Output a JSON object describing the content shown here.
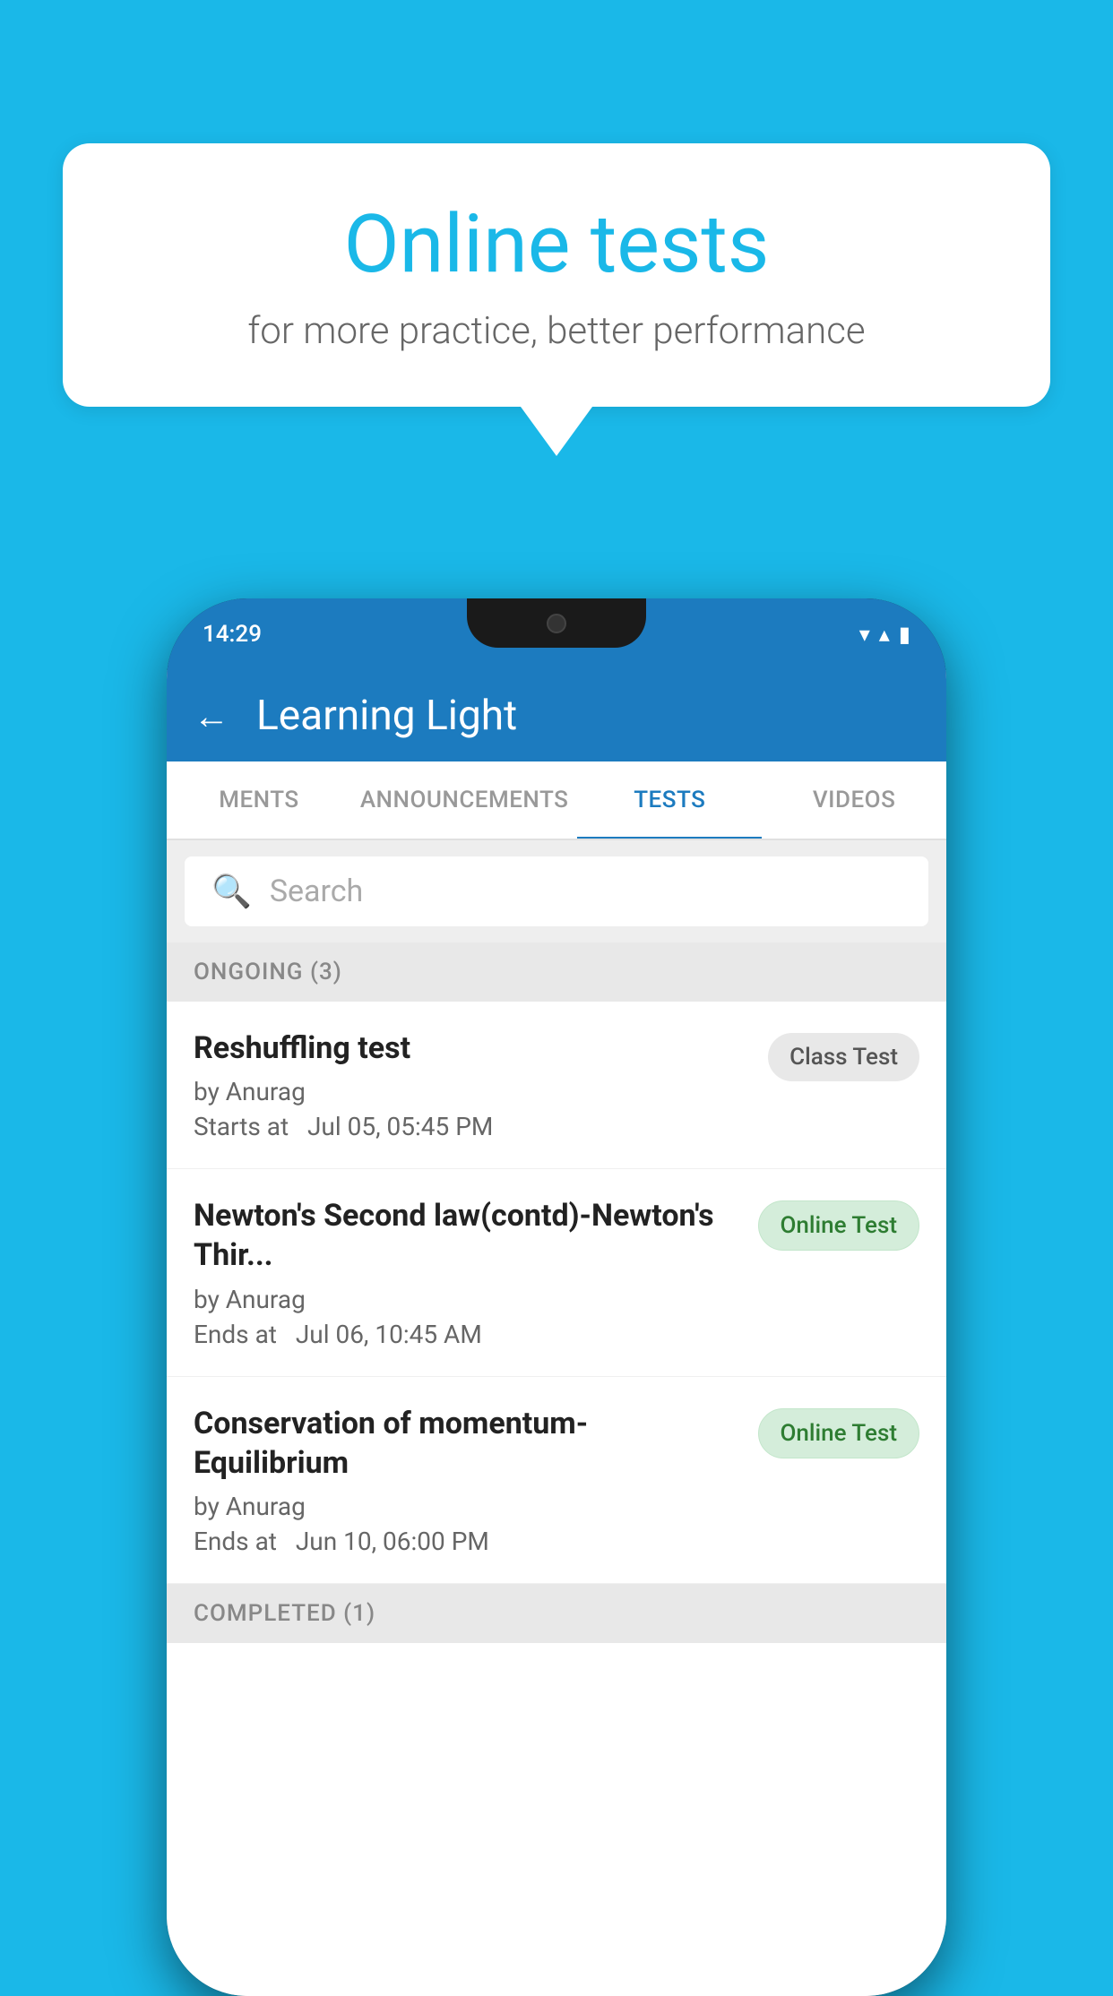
{
  "background": {
    "color": "#1ab8e8"
  },
  "speech_bubble": {
    "title": "Online tests",
    "subtitle": "for more practice, better performance"
  },
  "phone": {
    "status_bar": {
      "time": "14:29",
      "wifi_icon": "▼",
      "signal_icon": "▲",
      "battery_icon": "▮"
    },
    "header": {
      "back_label": "←",
      "title": "Learning Light"
    },
    "tabs": [
      {
        "label": "MENTS",
        "active": false
      },
      {
        "label": "ANNOUNCEMENTS",
        "active": false
      },
      {
        "label": "TESTS",
        "active": true
      },
      {
        "label": "VIDEOS",
        "active": false
      }
    ],
    "search": {
      "placeholder": "Search"
    },
    "sections": [
      {
        "title": "ONGOING (3)",
        "tests": [
          {
            "name": "Reshuffling test",
            "author": "by Anurag",
            "time_label": "Starts at",
            "time": "Jul 05, 05:45 PM",
            "badge": "Class Test",
            "badge_type": "class"
          },
          {
            "name": "Newton's Second law(contd)-Newton's Thir...",
            "author": "by Anurag",
            "time_label": "Ends at",
            "time": "Jul 06, 10:45 AM",
            "badge": "Online Test",
            "badge_type": "online"
          },
          {
            "name": "Conservation of momentum-Equilibrium",
            "author": "by Anurag",
            "time_label": "Ends at",
            "time": "Jun 10, 06:00 PM",
            "badge": "Online Test",
            "badge_type": "online"
          }
        ]
      },
      {
        "title": "COMPLETED (1)",
        "tests": []
      }
    ]
  }
}
